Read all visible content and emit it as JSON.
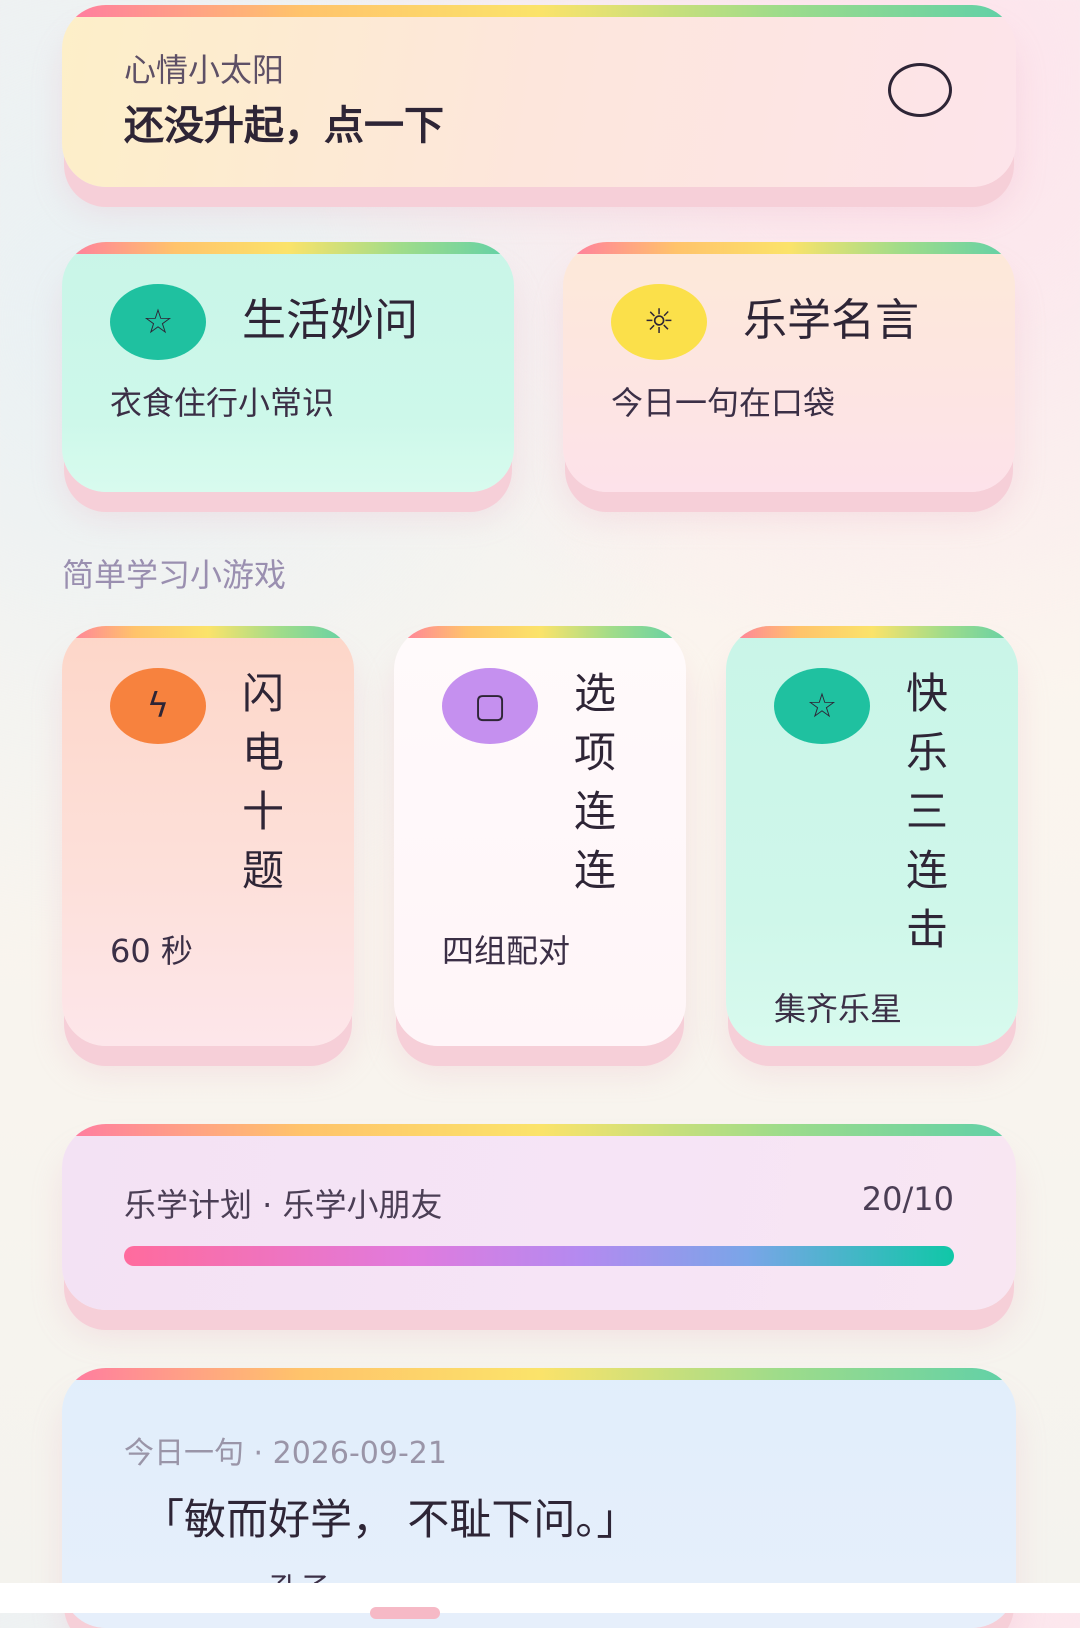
{
  "mood": {
    "label": "心情小太阳",
    "title": "还没升起，点一下"
  },
  "features": [
    {
      "title": "生活妙问",
      "subtitle": "衣食住行小常识",
      "icon": "star-icon",
      "color": "#1fc1a0"
    },
    {
      "title": "乐学名言",
      "subtitle": "今日一句在口袋",
      "icon": "sun-icon",
      "color": "#fbe04a"
    }
  ],
  "section_title": "简单学习小游戏",
  "games": [
    {
      "title": "闪电十题",
      "subtitle": "60 秒",
      "icon": "lightning-icon",
      "color": "#f7823e"
    },
    {
      "title": "选项连连",
      "subtitle": "四组配对",
      "icon": "card-icon",
      "color": "#c590ef"
    },
    {
      "title": "快乐三连击",
      "subtitle": "集齐乐星",
      "icon": "star-icon",
      "color": "#1fc1a0"
    }
  ],
  "plan": {
    "title": "乐学计划 · 乐学小朋友",
    "count": "20/10",
    "progress": 1.0
  },
  "daily": {
    "date_label": "今日一句 · 2026-09-21",
    "quote": "「敏而好学， 不耻下问。」",
    "author": "孔子"
  },
  "icons": {
    "star": "☆",
    "sun": "☼",
    "lightning": "ϟ",
    "card": "▢"
  }
}
